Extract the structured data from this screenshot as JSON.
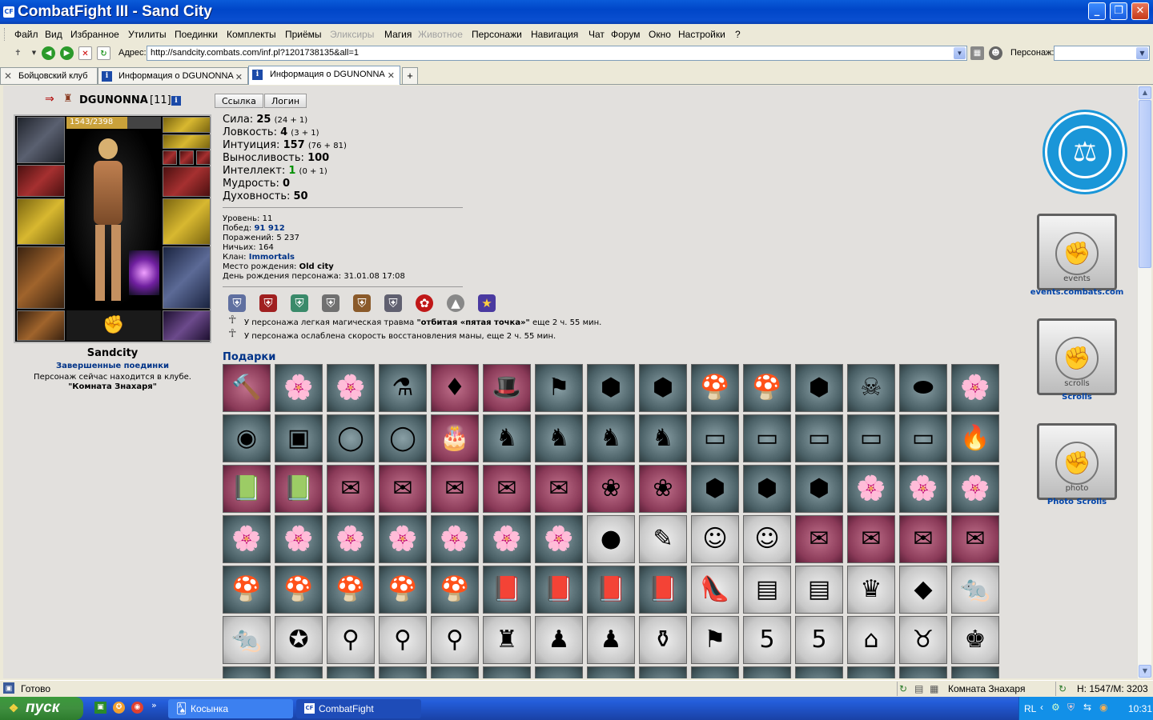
{
  "window": {
    "title": "CombatFight III - Sand City",
    "app_icon": "CF"
  },
  "menu": [
    "Файл",
    "Вид",
    "Избранное",
    "Утилиты",
    "Поединки",
    "Комплекты",
    "Приёмы",
    "Эликсиры",
    "Магия",
    "Животное",
    "Персонажи",
    "Навигация",
    "Чат",
    "Форум",
    "Окно",
    "Настройки",
    "?"
  ],
  "menu_disabled": [
    "Эликсиры",
    "Животное"
  ],
  "address": {
    "label": "Адрес:",
    "url": "http://sandcity.combats.com/inf.pl?1201738135&all=1"
  },
  "character_select": {
    "label": "Персонаж:",
    "value": ""
  },
  "tabs": [
    {
      "label": "Бойцовский клуб",
      "active": false
    },
    {
      "label": "Информация о DGUNONNA",
      "active": false
    },
    {
      "label": "Информация о DGUNONNA",
      "active": true
    }
  ],
  "character": {
    "name": "DGUNONNA",
    "level": "[11]",
    "hp": "1543/2398",
    "city": "Sandcity",
    "battles_link": "Завершенные поединки",
    "location_text": "Персонаж сейчас находится в клубе.",
    "location_room": "\"Комната Знахаря\""
  },
  "buttons": {
    "link": "Ссылка",
    "login": "Логин"
  },
  "stats": [
    {
      "name": "Сила:",
      "value": "25",
      "detail": "(24 + 1)"
    },
    {
      "name": "Ловкость:",
      "value": "4",
      "detail": "(3 + 1)"
    },
    {
      "name": "Интуиция:",
      "value": "157",
      "detail": "(76 + 81)"
    },
    {
      "name": "Выносливость:",
      "value": "100",
      "detail": ""
    },
    {
      "name": "Интеллект:",
      "value": "1",
      "detail": "(0 + 1)"
    },
    {
      "name": "Мудрость:",
      "value": "0",
      "detail": ""
    },
    {
      "name": "Духовность:",
      "value": "50",
      "detail": ""
    }
  ],
  "info": {
    "level_label": "Уровень:",
    "level": "11",
    "wins_label": "Побед:",
    "wins": "91 912",
    "losses_label": "Поражений:",
    "losses": "5 237",
    "draws_label": "Ничьих:",
    "draws": "164",
    "clan_label": "Клан:",
    "clan": "Immortals",
    "birthplace_label": "Место рождения:",
    "birthplace": "Old city",
    "birthday_label": "День рождения персонажа:",
    "birthday": "31.01.08 17:08"
  },
  "effects": [
    {
      "prefix": "У персонажа легкая магическая травма",
      "bold": "\"отбитая «пятая точка»\"",
      "suffix": "еще 2 ч. 55 мин."
    },
    {
      "prefix": "У персонажа ослаблена скорость восстановления маны, еще 2 ч. 55 мин.",
      "bold": "",
      "suffix": ""
    }
  ],
  "gifts_title": "Подарки",
  "gifts": [
    [
      "hammer",
      "flower",
      "flower",
      "potion",
      "ruby",
      "hat",
      "banner",
      "gem",
      "gem",
      "mushroom",
      "mushroom",
      "gem",
      "skull-cup",
      "amber",
      "flower"
    ],
    [
      "amulet",
      "chest",
      "pearls",
      "pearls",
      "cake",
      "statue",
      "statue",
      "statue",
      "statue",
      "box",
      "box",
      "box",
      "box",
      "box",
      "flame"
    ],
    [
      "book",
      "book",
      "card",
      "card",
      "card",
      "card",
      "card",
      "plate",
      "plate",
      "gem",
      "gem",
      "gem",
      "flower",
      "flower",
      "flower"
    ],
    [
      "flower",
      "flower",
      "flower",
      "flower",
      "flower",
      "flower",
      "flower",
      "crystal-ball",
      "scroll",
      "smiley",
      "smiley",
      "letter",
      "letter",
      "letter",
      "letter"
    ],
    [
      "mushroom",
      "mushroom",
      "mushroom",
      "mushroom",
      "mushroom",
      "tome",
      "tome",
      "tome",
      "tome",
      "shoe",
      "treasure",
      "treasure",
      "jester-hat",
      "cheese",
      "rat"
    ],
    [
      "rat",
      "medallion",
      "mirror",
      "mirror",
      "mirror",
      "warrior",
      "goblin",
      "goblin",
      "potions",
      "mug",
      "number-5",
      "number-5",
      "year-2008",
      "cow",
      "knight"
    ]
  ],
  "gift_icons": {
    "hammer": "🔨",
    "flower": "🌸",
    "potion": "⚗",
    "ruby": "♦",
    "hat": "🎩",
    "banner": "⚑",
    "gem": "⬢",
    "mushroom": "🍄",
    "skull-cup": "☠",
    "amber": "⬬",
    "amulet": "◉",
    "chest": "▣",
    "pearls": "◯",
    "cake": "🎂",
    "statue": "♞",
    "box": "▭",
    "flame": "🔥",
    "book": "📗",
    "card": "✉",
    "plate": "❀",
    "crystal-ball": "●",
    "scroll": "✎",
    "smiley": "☺",
    "letter": "✉",
    "tome": "📕",
    "shoe": "👠",
    "treasure": "▤",
    "jester-hat": "♛",
    "cheese": "◆",
    "rat": "🐀",
    "medallion": "✪",
    "mirror": "⚲",
    "warrior": "♜",
    "goblin": "♟",
    "potions": "⚱",
    "mug": "⚑",
    "number-5": "5",
    "year-2008": "⌂",
    "cow": "♉",
    "knight": "♚"
  },
  "sidebar_links": [
    {
      "label": "events.combats.com",
      "icon_text": "events"
    },
    {
      "label": "Scrolls",
      "icon_text": "scrolls"
    },
    {
      "label": "Photo Scrolls",
      "icon_text": "photo"
    }
  ],
  "status": {
    "text": "Готово",
    "room": "Комната Знахаря",
    "hm": "H: 1547/M: 3203"
  },
  "taskbar": {
    "start": "пуск",
    "tasks": [
      "Косынка",
      "CombatFight"
    ],
    "lang": "RL",
    "time": "10:31"
  }
}
